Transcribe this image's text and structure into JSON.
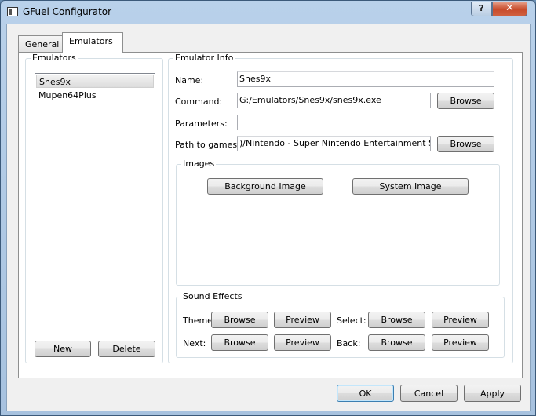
{
  "window": {
    "title": "GFuel Configurator",
    "help_label": "?",
    "close_label": "✕"
  },
  "tabs": [
    {
      "label": "General"
    },
    {
      "label": "Emulators"
    }
  ],
  "emulators": {
    "title": "Emulators",
    "items": [
      {
        "label": "Snes9x"
      },
      {
        "label": "Mupen64Plus"
      }
    ],
    "new_label": "New",
    "delete_label": "Delete"
  },
  "emulator_info": {
    "title": "Emulator Info",
    "name_label": "Name:",
    "name_value": "Snes9x",
    "command_label": "Command:",
    "command_value": "G:/Emulators/Snes9x/snes9x.exe",
    "parameters_label": "Parameters:",
    "parameters_value": "",
    "path_label": "Path to games:",
    "path_value": ")/Nintendo - Super Nintendo Entertainment System",
    "browse_label": "Browse"
  },
  "images": {
    "title": "Images",
    "background_label": "Background Image",
    "system_label": "System Image"
  },
  "sound_effects": {
    "title": "Sound Effects",
    "theme_label": "Theme:",
    "select_label": "Select:",
    "next_label": "Next:",
    "back_label": "Back:",
    "browse_label": "Browse",
    "preview_label": "Preview"
  },
  "footer": {
    "ok_label": "OK",
    "cancel_label": "Cancel",
    "apply_label": "Apply"
  }
}
